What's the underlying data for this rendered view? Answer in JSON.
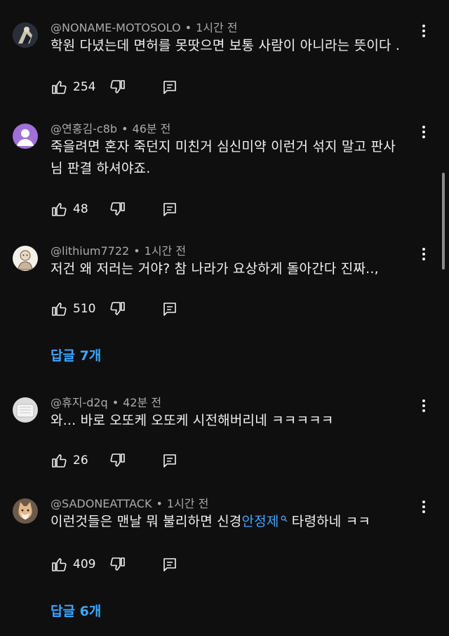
{
  "comments": [
    {
      "author": "@NONAME-MOTOSOLO",
      "time": "1시간 전",
      "lines": [
        "학원 다녔는데 면허를 못땃으면 보통 사람이 아니라는 뜻이다 ."
      ],
      "likes": "254",
      "avatar": "dark-figure-avatar"
    },
    {
      "author": "@연홍김-c8b",
      "time": "46분 전",
      "lines": [
        "죽을려면 혼자 죽던지  미친거  심신미약 이런거 섞지 말고  판사",
        "님 판결 하셔야죠."
      ],
      "likes": "48",
      "avatar": "default-person-avatar",
      "avatar_color": "#a070d8"
    },
    {
      "author": "@lithium7722",
      "time": "1시간 전",
      "lines": [
        "저건  왜 저러는 거야? 참 나라가 요상하게 돌아간다 진짜..,"
      ],
      "likes": "510",
      "avatar": "cartoon-avatar",
      "replies": "답글 7개"
    },
    {
      "author": "@휴지-d2q",
      "time": "42분 전",
      "lines": [
        "와... 바로 오또케 오또케 시전해버리네 ㅋㅋㅋㅋㅋ"
      ],
      "likes": "26",
      "avatar": "white-object-avatar"
    },
    {
      "author": "@SADONEATTACK",
      "time": "1시간 전",
      "text_before": "이런것들은 맨날 뭐 불리하면 신경",
      "link_text": "안정제",
      "text_after": " 타령하네 ㅋㅋ",
      "likes": "409",
      "avatar": "cat-avatar",
      "replies": "답글 6개"
    }
  ],
  "colors": {
    "background": "#0f0f0f",
    "text": "#f1f1f1",
    "meta": "#aaaaaa",
    "link": "#3ea6ff"
  }
}
